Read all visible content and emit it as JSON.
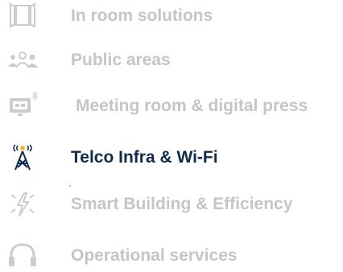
{
  "menu": {
    "items": [
      {
        "label": "In room solutions",
        "icon": "room-panel-icon",
        "active": false
      },
      {
        "label": "Public areas",
        "icon": "people-group-icon",
        "active": false
      },
      {
        "label": "Meeting room & digital press",
        "icon": "screen-display-icon",
        "active": false
      },
      {
        "label": "Telco Infra & Wi-Fi",
        "icon": "antenna-tower-icon",
        "active": true
      },
      {
        "label": "Smart Building & Efficiency",
        "icon": "energy-bolt-icon",
        "active": false
      },
      {
        "label": "Operational services",
        "icon": "headset-icon",
        "active": false
      }
    ]
  },
  "colors": {
    "inactive": "#c2c6c9",
    "active": "#0f2a4a",
    "accent": "#f2b705"
  }
}
